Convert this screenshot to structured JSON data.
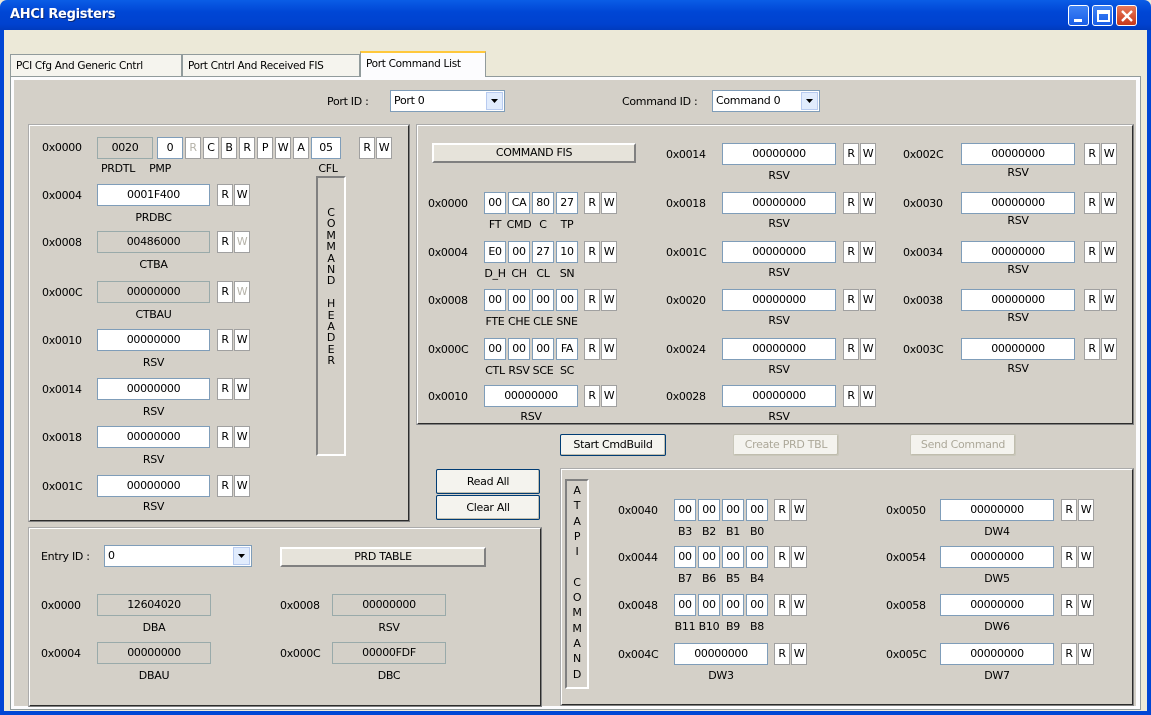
{
  "window": {
    "title": "AHCI Registers"
  },
  "tabs": [
    "PCI Cfg And Generic Cntrl",
    "Port Cntrl And Received FIS",
    "Port Command List"
  ],
  "port": {
    "label": "Port ID :",
    "value": "Port 0"
  },
  "command": {
    "label": "Command ID :",
    "value": "Command 0"
  },
  "rw": {
    "r": "R",
    "w": "W"
  },
  "header": {
    "vlabel": "C\nO\nM\nM\nA\nN\nD\n\nH\nE\nA\nD\nE\nR",
    "row0": {
      "addr": "0x0000",
      "prdtl": "0020",
      "pmp": "0",
      "bits": [
        "R",
        "C",
        "B",
        "R",
        "P",
        "W",
        "A"
      ],
      "cfl": "05",
      "cap_prdtl": "PRDTL",
      "cap_pmp": "PMP",
      "cap_cfl": "CFL"
    },
    "rows": [
      {
        "addr": "0x0004",
        "value": "0001F400",
        "cap": "PRDBC"
      },
      {
        "addr": "0x0008",
        "value": "00486000",
        "cap": "CTBA"
      },
      {
        "addr": "0x000C",
        "value": "00000000",
        "cap": "CTBAU"
      },
      {
        "addr": "0x0010",
        "value": "00000000",
        "cap": "RSV"
      },
      {
        "addr": "0x0014",
        "value": "00000000",
        "cap": "RSV"
      },
      {
        "addr": "0x0018",
        "value": "00000000",
        "cap": "RSV"
      },
      {
        "addr": "0x001C",
        "value": "00000000",
        "cap": "RSV"
      }
    ]
  },
  "fis": {
    "title": "COMMAND FIS",
    "byte_rows": [
      {
        "addr": "0x0000",
        "bytes": [
          "00",
          "CA",
          "80",
          "27"
        ],
        "caps": [
          "FT",
          "CMD",
          "C",
          "TP"
        ]
      },
      {
        "addr": "0x0004",
        "bytes": [
          "E0",
          "00",
          "27",
          "10"
        ],
        "caps": [
          "D_H",
          "CH",
          "CL",
          "SN"
        ]
      },
      {
        "addr": "0x0008",
        "bytes": [
          "00",
          "00",
          "00",
          "00"
        ],
        "caps": [
          "FTE",
          "CHE",
          "CLE",
          "SNE"
        ]
      },
      {
        "addr": "0x000C",
        "bytes": [
          "00",
          "00",
          "00",
          "FA"
        ],
        "caps": [
          "CTL",
          "RSV",
          "SCE",
          "SC"
        ]
      }
    ],
    "row10": {
      "addr": "0x0010",
      "value": "00000000",
      "cap": "RSV"
    },
    "col2": [
      {
        "addr": "0x0014",
        "value": "00000000",
        "cap": "RSV"
      },
      {
        "addr": "0x0018",
        "value": "00000000",
        "cap": "RSV"
      },
      {
        "addr": "0x001C",
        "value": "00000000",
        "cap": "RSV"
      },
      {
        "addr": "0x0020",
        "value": "00000000",
        "cap": "RSV"
      },
      {
        "addr": "0x0024",
        "value": "00000000",
        "cap": "RSV"
      },
      {
        "addr": "0x0028",
        "value": "00000000",
        "cap": "RSV"
      }
    ],
    "col3": [
      {
        "addr": "0x002C",
        "value": "00000000",
        "cap": "RSV"
      },
      {
        "addr": "0x0030",
        "value": "00000000",
        "cap": "RSV"
      },
      {
        "addr": "0x0034",
        "value": "00000000",
        "cap": "RSV"
      },
      {
        "addr": "0x0038",
        "value": "00000000",
        "cap": "RSV"
      },
      {
        "addr": "0x003C",
        "value": "00000000",
        "cap": "RSV"
      }
    ]
  },
  "actions": {
    "start": "Start CmdBuild",
    "create": "Create PRD TBL",
    "send": "Send Command",
    "read_all": "Read All",
    "clear_all": "Clear All"
  },
  "prd": {
    "entry_label": "Entry ID :",
    "entry_value": "0",
    "title": "PRD TABLE",
    "fields": [
      {
        "addr": "0x0000",
        "value": "12604020",
        "cap": "DBA"
      },
      {
        "addr": "0x0004",
        "value": "00000000",
        "cap": "DBAU"
      },
      {
        "addr": "0x0008",
        "value": "00000000",
        "cap": "RSV"
      },
      {
        "addr": "0x000C",
        "value": "00000FDF",
        "cap": "DBC"
      }
    ]
  },
  "atapi": {
    "vlabel": "A\nT\nA\nP\nI\n\nC\nO\nM\nM\nA\nN\nD",
    "byte_rows": [
      {
        "addr": "0x0040",
        "bytes": [
          "00",
          "00",
          "00",
          "00"
        ],
        "caps": [
          "B3",
          "B2",
          "B1",
          "B0"
        ]
      },
      {
        "addr": "0x0044",
        "bytes": [
          "00",
          "00",
          "00",
          "00"
        ],
        "caps": [
          "B7",
          "B6",
          "B5",
          "B4"
        ]
      },
      {
        "addr": "0x0048",
        "bytes": [
          "00",
          "00",
          "00",
          "00"
        ],
        "caps": [
          "B11",
          "B10",
          "B9",
          "B8"
        ]
      }
    ],
    "row4c": {
      "addr": "0x004C",
      "value": "00000000",
      "cap": "DW3"
    },
    "col2": [
      {
        "addr": "0x0050",
        "value": "00000000",
        "cap": "DW4"
      },
      {
        "addr": "0x0054",
        "value": "00000000",
        "cap": "DW5"
      },
      {
        "addr": "0x0058",
        "value": "00000000",
        "cap": "DW6"
      },
      {
        "addr": "0x005C",
        "value": "00000000",
        "cap": "DW7"
      }
    ]
  }
}
